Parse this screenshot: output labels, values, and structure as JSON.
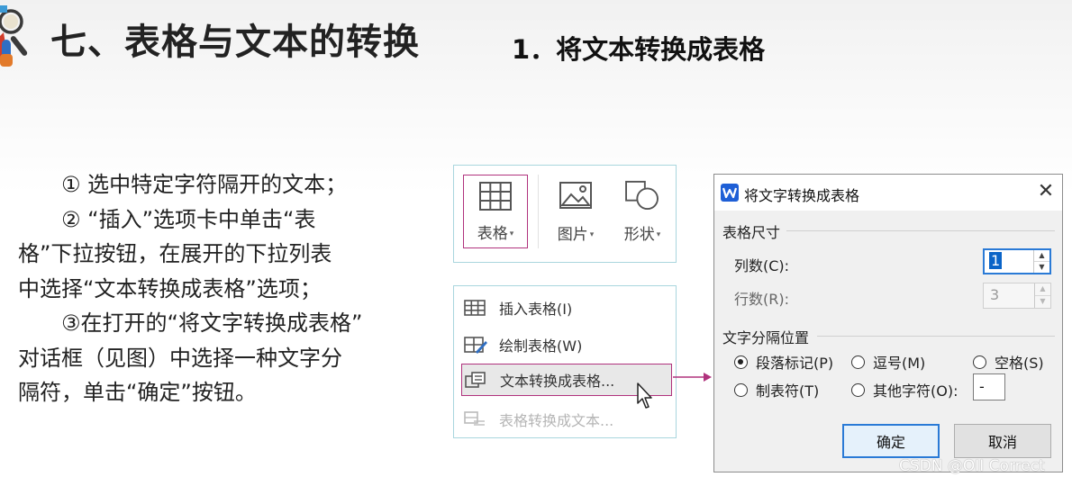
{
  "header": {
    "title": "七、表格与文本的转换",
    "section_title": "1．将文本转换成表格"
  },
  "instructions": {
    "step1": "① 选中特定字符隔开的文本；",
    "step2_a": "②  “插入”选项卡中单击“表",
    "step2_b": "格”下拉按钮，在展开的下拉列表",
    "step2_c": "中选择“文本转换成表格”选项；",
    "step3_a": "③在打开的“将文字转换成表格”",
    "step3_b": "对话框（见图）中选择一种文字分",
    "step3_c": "隔符，单击“确定”按钮。"
  },
  "ribbon": {
    "table_label": "表格",
    "picture_label": "图片",
    "shape_label": "形状",
    "caret": "▾"
  },
  "menu": {
    "insert_table": "插入表格(I)",
    "draw_table": "绘制表格(W)",
    "text_to_table": "文本转换成表格...",
    "table_to_text": "表格转换成文本..."
  },
  "dialog": {
    "title": "将文字转换成表格",
    "close_glyph": "✕",
    "size_group": "表格尺寸",
    "columns_label": "列数(C):",
    "columns_value": "1",
    "rows_label": "行数(R):",
    "rows_value": "3",
    "sep_group": "文字分隔位置",
    "opt_paragraph": "段落标记(P)",
    "opt_comma": "逗号(M)",
    "opt_space": "空格(S)",
    "opt_tab": "制表符(T)",
    "opt_other": "其他字符(O):",
    "other_value": "-",
    "ok": "确定",
    "cancel": "取消",
    "spin_up": "▲",
    "spin_down": "▼",
    "selected_option": "段落标记(P)"
  },
  "watermark": "CSDN @OII Correct",
  "colors": {
    "highlight_border": "#b0327d",
    "panel_border": "#a9d6de",
    "focus_blue": "#2a7ad6",
    "wps_blue": "#1e5fd6"
  }
}
